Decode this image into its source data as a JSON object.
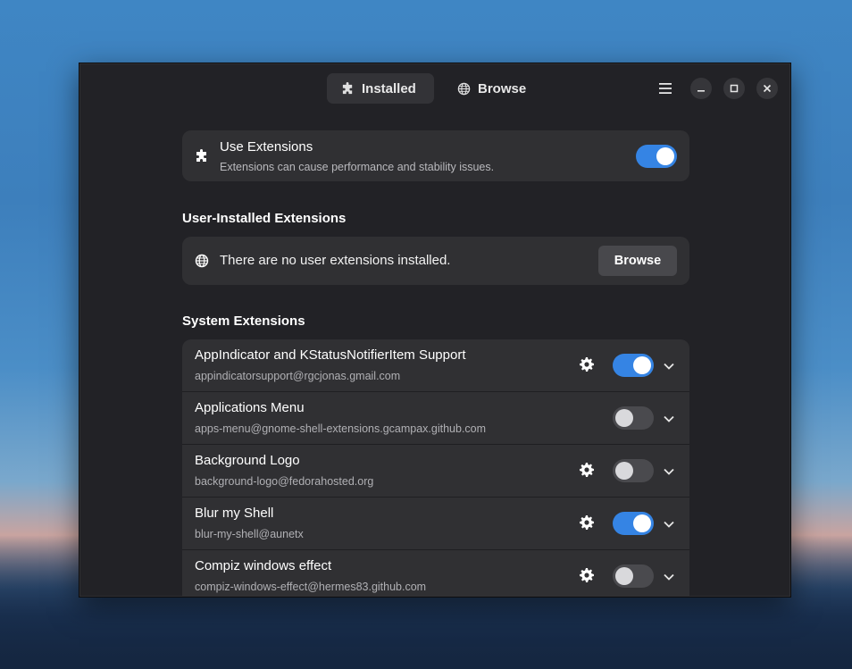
{
  "header": {
    "tabs": [
      {
        "label": "Installed",
        "icon": "puzzle-icon",
        "active": true
      },
      {
        "label": "Browse",
        "icon": "globe-icon",
        "active": false
      }
    ],
    "window_controls": [
      "menu-icon",
      "minimize-icon",
      "maximize-icon",
      "close-icon"
    ]
  },
  "use_extensions": {
    "title": "Use Extensions",
    "subtitle": "Extensions can cause performance and stability issues.",
    "enabled": true
  },
  "user_section": {
    "title": "User-Installed Extensions",
    "empty_text": "There are no user extensions installed.",
    "browse_label": "Browse"
  },
  "system_section": {
    "title": "System Extensions",
    "items": [
      {
        "name": "AppIndicator and KStatusNotifierItem Support",
        "uuid": "appindicatorsupport@rgcjonas.gmail.com",
        "has_settings": true,
        "enabled": true
      },
      {
        "name": "Applications Menu",
        "uuid": "apps-menu@gnome-shell-extensions.gcampax.github.com",
        "has_settings": false,
        "enabled": false
      },
      {
        "name": "Background Logo",
        "uuid": "background-logo@fedorahosted.org",
        "has_settings": true,
        "enabled": false
      },
      {
        "name": "Blur my Shell",
        "uuid": "blur-my-shell@aunetx",
        "has_settings": true,
        "enabled": true
      },
      {
        "name": "Compiz windows effect",
        "uuid": "compiz-windows-effect@hermes83.github.com",
        "has_settings": true,
        "enabled": false
      }
    ]
  },
  "colors": {
    "accent": "#3584e4",
    "window_bg": "#222226",
    "card_bg": "#303033"
  }
}
